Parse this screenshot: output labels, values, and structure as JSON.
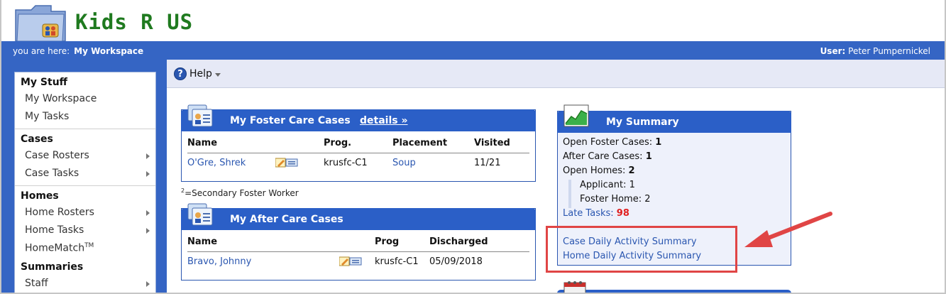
{
  "app": {
    "title": "Kids R US"
  },
  "bar": {
    "you_are_here_label": "you are here:",
    "location": "My Workspace",
    "user_label": "User:",
    "user_name": "Peter Pumpernickel"
  },
  "sidebar": {
    "groups": [
      {
        "heading": "My Stuff",
        "items": [
          {
            "label": "My Workspace"
          },
          {
            "label": "My Tasks"
          }
        ]
      },
      {
        "heading": "Cases",
        "items": [
          {
            "label": "Case Rosters"
          },
          {
            "label": "Case Tasks"
          }
        ]
      },
      {
        "heading": "Homes",
        "items": [
          {
            "label": "Home Rosters"
          },
          {
            "label": "Home Tasks"
          },
          {
            "label": "HomeMatch",
            "sup": "TM"
          }
        ]
      },
      {
        "heading": "Summaries",
        "items": [
          {
            "label": "Staff"
          }
        ]
      }
    ]
  },
  "toolbar": {
    "help_label": "Help"
  },
  "foster": {
    "title": "My Foster Care Cases",
    "details_link": "details »",
    "columns": [
      "Name",
      "Prog.",
      "Placement",
      "Visited"
    ],
    "rows": [
      {
        "name": "O'Gre, Shrek",
        "prog": "krusfc-C1",
        "placement": "Soup",
        "visited": "11/21"
      }
    ]
  },
  "footnote": {
    "sup": "2",
    "text": "=Secondary Foster Worker"
  },
  "aftercare": {
    "title": "My After Care Cases",
    "columns": [
      "Name",
      "Prog",
      "Discharged"
    ],
    "rows": [
      {
        "name": "Bravo, Johnny",
        "prog": "krusfc-C1",
        "discharged": "05/09/2018"
      }
    ]
  },
  "summary": {
    "title": "My Summary",
    "open_foster_label": "Open Foster Cases:",
    "open_foster": "1",
    "after_care_label": "After Care Cases:",
    "after_care": "1",
    "open_homes_label": "Open Homes:",
    "open_homes": "2",
    "applicant_label": "Applicant:",
    "applicant": "1",
    "foster_home_label": "Foster Home:",
    "foster_home": "2",
    "late_label": "Late Tasks:",
    "late": "98",
    "case_daily_link": "Case Daily Activity Summary",
    "home_daily_link": "Home Daily Activity Summary"
  },
  "colors": {
    "header_blue": "#3565c4",
    "panel_blue": "#2b5fc7",
    "title_green": "#1f7a1f",
    "callout_red": "#e04545"
  }
}
